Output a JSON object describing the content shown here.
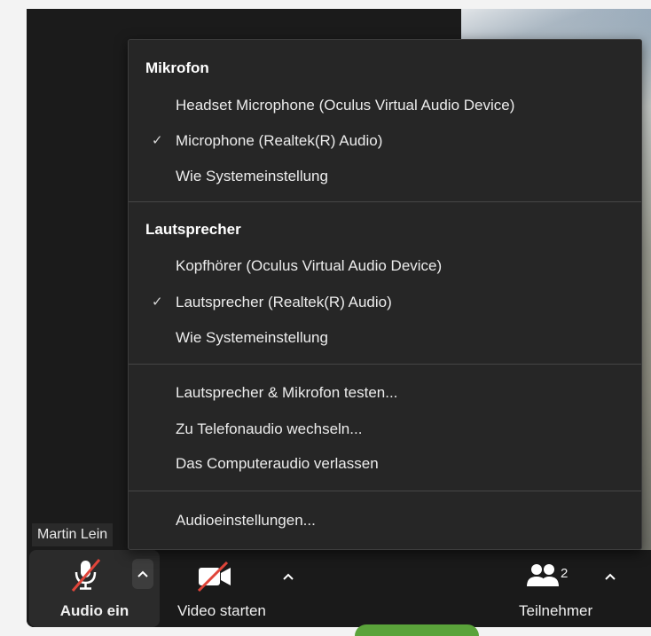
{
  "menu": {
    "microphone_header": "Mikrofon",
    "microphones": [
      {
        "label": "Headset Microphone (Oculus Virtual Audio Device)",
        "selected": false
      },
      {
        "label": "Microphone (Realtek(R) Audio)",
        "selected": true
      },
      {
        "label": "Wie Systemeinstellung",
        "selected": false
      }
    ],
    "speaker_header": "Lautsprecher",
    "speakers": [
      {
        "label": "Kopfhörer (Oculus Virtual Audio Device)",
        "selected": false
      },
      {
        "label": "Lautsprecher (Realtek(R) Audio)",
        "selected": true
      },
      {
        "label": "Wie Systemeinstellung",
        "selected": false
      }
    ],
    "actions": [
      "Lautsprecher & Mikrofon testen...",
      "Zu Telefonaudio wechseln...",
      "Das Computeraudio verlassen"
    ],
    "settings": "Audioeinstellungen...",
    "check_glyph": "✓"
  },
  "participant": {
    "name": "Martin Lein"
  },
  "toolbar": {
    "audio_label": "Audio ein",
    "video_label": "Video starten",
    "participants_label": "Teilnehmer",
    "participants_count": "2"
  },
  "colors": {
    "mute_red": "#e0453a",
    "menu_bg": "#262626",
    "toolbar_bg": "#1a1a1a"
  },
  "icons": {
    "mic": "microphone-muted-icon",
    "camera": "video-camera-off-icon",
    "participants": "participants-icon",
    "caret": "chevron-up-icon",
    "check": "checkmark-icon"
  }
}
